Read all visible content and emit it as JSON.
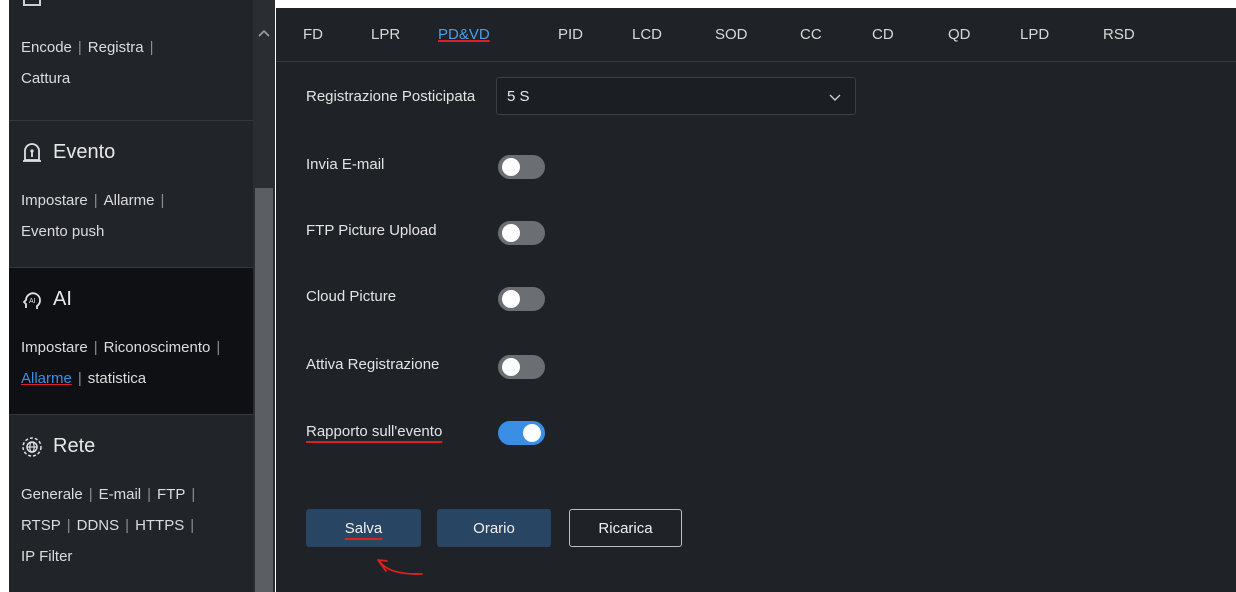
{
  "sidebar": {
    "record": {
      "links": [
        "Encode",
        "Registra",
        "Cattura"
      ]
    },
    "evento": {
      "title": "Evento",
      "links": [
        "Impostare",
        "Allarme",
        "Evento push"
      ]
    },
    "ai": {
      "title": "AI",
      "links": [
        "Impostare",
        "Riconoscimento",
        "Allarme",
        "statistica"
      ]
    },
    "rete": {
      "title": "Rete",
      "links": [
        "Generale",
        "E-mail",
        "FTP",
        "RTSP",
        "DDNS",
        "HTTPS",
        "IP Filter"
      ]
    },
    "icons": {
      "evento": "alarm-icon",
      "ai": "ai-head-icon",
      "rete": "network-globe-icon",
      "scroll_up": "chevron-up-icon"
    }
  },
  "tabs": [
    "FD",
    "LPR",
    "PD&VD",
    "PID",
    "LCD",
    "SOD",
    "CC",
    "CD",
    "QD",
    "LPD",
    "RSD"
  ],
  "active_tab": "PD&VD",
  "form": {
    "delay_label": "Registrazione Posticipata",
    "delay_value": "5 S",
    "rows": [
      {
        "label": "Invia E-mail",
        "on": false
      },
      {
        "label": "FTP Picture Upload",
        "on": false
      },
      {
        "label": "Cloud Picture",
        "on": false
      },
      {
        "label": "Attiva Registrazione",
        "on": false
      },
      {
        "label": "Rapporto sull'evento",
        "on": true
      }
    ]
  },
  "buttons": {
    "save": "Salva",
    "schedule": "Orario",
    "reload": "Ricarica"
  },
  "colors": {
    "accent": "#3a8ee6",
    "annotation": "#e02020",
    "panel": "#1f2226",
    "sidebar": "#212429"
  }
}
